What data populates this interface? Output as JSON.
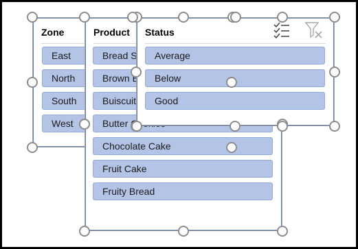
{
  "slicers": {
    "zone": {
      "title": "Zone",
      "items": [
        {
          "label": "East"
        },
        {
          "label": "North"
        },
        {
          "label": "South"
        },
        {
          "label": "West"
        }
      ]
    },
    "product": {
      "title": "Product",
      "items": [
        {
          "label": "Bread Sticks"
        },
        {
          "label": "Brown Bread"
        },
        {
          "label": "Buiscuits"
        },
        {
          "label": "Butter Cookies"
        },
        {
          "label": "Chocolate Cake"
        },
        {
          "label": "Fruit Cake"
        },
        {
          "label": "Fruity Bread"
        }
      ]
    },
    "status": {
      "title": "Status",
      "items": [
        {
          "label": "Average"
        },
        {
          "label": "Below"
        },
        {
          "label": "Good"
        }
      ],
      "icons": {
        "multiselect": "multi-select-icon",
        "clear_filter": "clear-filter-icon"
      }
    }
  },
  "colors": {
    "item_fill": "#b4c4e7",
    "item_border": "#8faadc",
    "slicer_border": "#5b7bb4",
    "handle_border": "#8c8c8c"
  }
}
